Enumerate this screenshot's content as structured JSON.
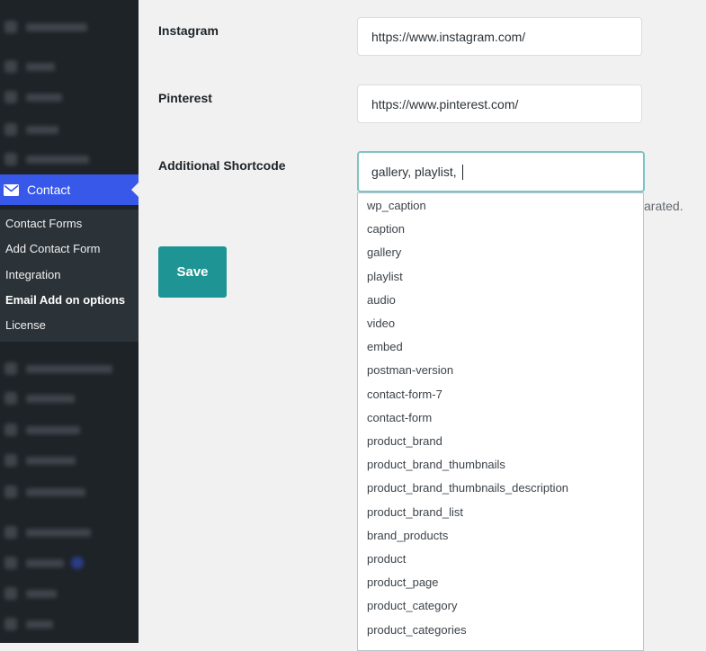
{
  "sidebar": {
    "active_item": {
      "label": "Contact",
      "icon": "envelope-icon"
    },
    "submenu": [
      {
        "label": "Contact Forms"
      },
      {
        "label": "Add Contact Form"
      },
      {
        "label": "Integration"
      },
      {
        "label": "Email Add on options"
      },
      {
        "label": "License"
      }
    ]
  },
  "form": {
    "instagram": {
      "label": "Instagram",
      "value": "https://www.instagram.com/"
    },
    "pinterest": {
      "label": "Pinterest",
      "value": "https://www.pinterest.com/"
    },
    "shortcode": {
      "label": "Additional Shortcode",
      "value": "gallery, playlist, ",
      "help_visible": "arated."
    },
    "save_label": "Save"
  },
  "dropdown": {
    "options": [
      "wp_caption",
      "caption",
      "gallery",
      "playlist",
      "audio",
      "video",
      "embed",
      "postman-version",
      "contact-form-7",
      "contact-form",
      "product_brand",
      "product_brand_thumbnails",
      "product_brand_thumbnails_description",
      "product_brand_list",
      "brand_products",
      "product",
      "product_page",
      "product_category",
      "product_categories"
    ]
  },
  "colors": {
    "accent": "#3858e9",
    "button": "#1f9494",
    "sidebar": "#1d2327"
  }
}
